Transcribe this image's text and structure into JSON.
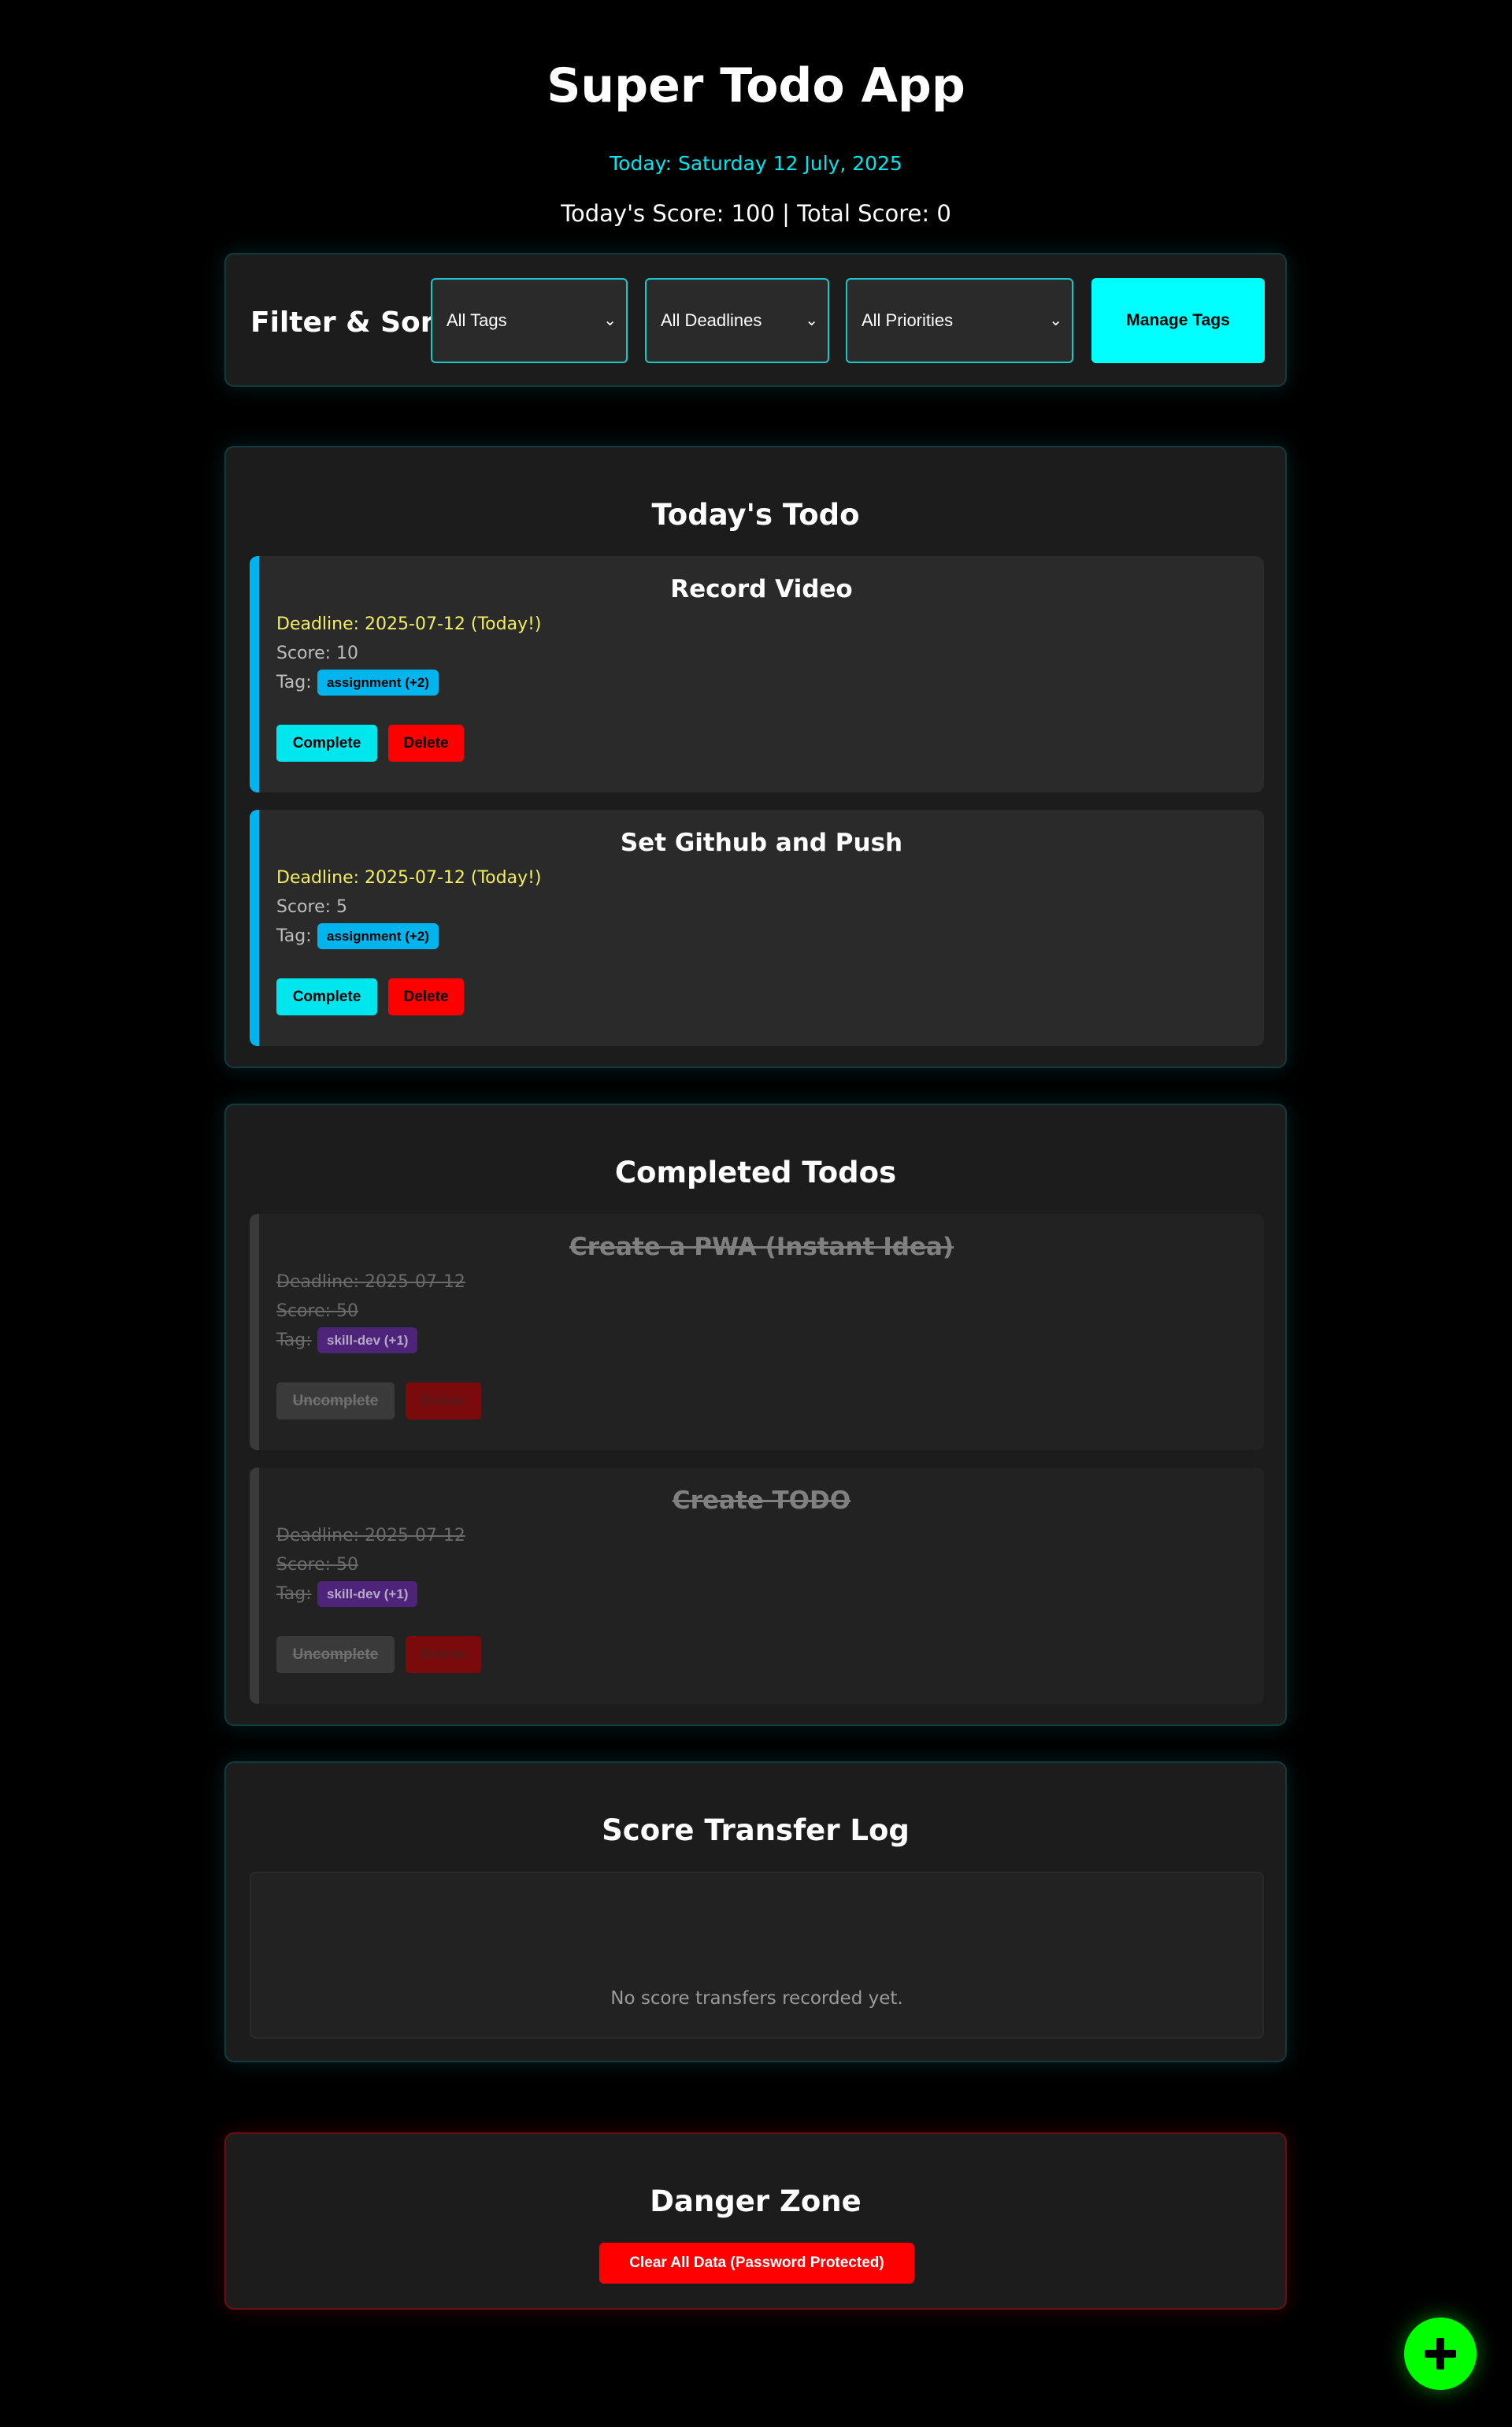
{
  "app": {
    "title": "Super Todo App",
    "date_text": "Today: Saturday 12 July, 2025",
    "score_text": "Today's Score: 100 | Total Score: 0"
  },
  "filter": {
    "title": "Filter & Sort",
    "tags_value": "All Tags",
    "deadlines_value": "All Deadlines",
    "priorities_value": "All Priorities",
    "manage_tags_label": "Manage Tags"
  },
  "today": {
    "title": "Today's Todo",
    "items": [
      {
        "title": "Record Video",
        "deadline": "Deadline: 2025-07-12 (Today!)",
        "score": "Score: 10",
        "tag_label": "Tag:",
        "tag": "assignment (+2)",
        "complete_label": "Complete",
        "delete_label": "Delete"
      },
      {
        "title": "Set Github and Push",
        "deadline": "Deadline: 2025-07-12 (Today!)",
        "score": "Score: 5",
        "tag_label": "Tag:",
        "tag": "assignment (+2)",
        "complete_label": "Complete",
        "delete_label": "Delete"
      }
    ]
  },
  "completed": {
    "title": "Completed Todos",
    "items": [
      {
        "title": "Create a PWA (Instant Idea)",
        "deadline": "Deadline: 2025-07-12",
        "score": "Score: 50",
        "tag_label": "Tag:",
        "tag": "skill-dev (+1)",
        "uncomplete_label": "Uncomplete",
        "delete_label": "Delete"
      },
      {
        "title": "Create TODO",
        "deadline": "Deadline: 2025-07-12",
        "score": "Score: 50",
        "tag_label": "Tag:",
        "tag": "skill-dev (+1)",
        "uncomplete_label": "Uncomplete",
        "delete_label": "Delete"
      }
    ]
  },
  "score_log": {
    "title": "Score Transfer Log",
    "empty_text": "No score transfers recorded yet."
  },
  "danger": {
    "title": "Danger Zone",
    "button_label": "Clear All Data (Password Protected)"
  },
  "fab": {
    "icon": "plus-icon"
  },
  "colors": {
    "accent": "#00ffff",
    "today_tag": "#00b4ee",
    "completed_tag": "#4d2479",
    "danger": "#ff0000",
    "fab": "#00ff00",
    "deadline_text": "#f3ef5c"
  }
}
